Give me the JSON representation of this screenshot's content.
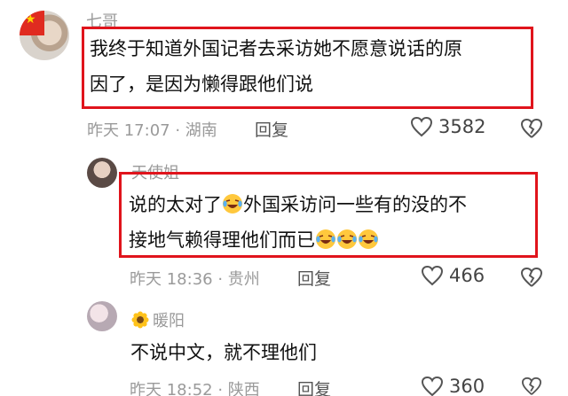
{
  "comments": [
    {
      "username": "七哥",
      "text_lines": [
        "我终于知道外国记者去采访她不愿意说话的原",
        "因了，是因为懒得跟他们说"
      ],
      "time": "昨天 17:07",
      "location": "湖南",
      "reply_label": "回复",
      "likes": "3582"
    },
    {
      "username": "天使姐",
      "line1_before": "说的太对了",
      "line1_after": "外国采访问一些有的没的不",
      "line2": "接地气赖得理他们而已",
      "time": "昨天 18:36",
      "location": "贵州",
      "reply_label": "回复",
      "likes": "466"
    },
    {
      "username": "暖阳",
      "name_icon": "sunflower-icon",
      "text": "不说中文，就不理他们",
      "time": "昨天 18:52",
      "location": "陕西",
      "reply_label": "回复",
      "likes": "360"
    }
  ],
  "separator": " · ",
  "icons": [
    "heart-icon",
    "broken-heart-icon",
    "crying-laugh-emoji-icon",
    "sunflower-icon"
  ],
  "colors": {
    "highlight_border": "#e0141c",
    "meta_gray": "#9a9a9a"
  }
}
